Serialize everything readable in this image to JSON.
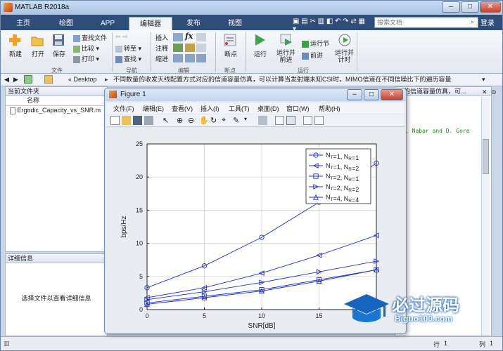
{
  "app": {
    "title": "MATLAB R2018a",
    "window_controls": {
      "minimize": "–",
      "maximize": "□",
      "close": "✕"
    }
  },
  "tabs": [
    {
      "label": "主页"
    },
    {
      "label": "绘图"
    },
    {
      "label": "APP"
    },
    {
      "label": "编辑器",
      "active": true
    },
    {
      "label": "发布"
    },
    {
      "label": "视图"
    }
  ],
  "search": {
    "placeholder": "搜索文档"
  },
  "login_label": "登录",
  "ribbon": {
    "file": {
      "new_label": "新建",
      "open_label": "打开",
      "save_label": "保存",
      "find_files_label": "查找文件",
      "compare_label": "比较",
      "print_label": "打印",
      "section_label": "文件"
    },
    "nav": {
      "goto_label": "转至",
      "find_label": "查找",
      "section_label": "导航"
    },
    "edit": {
      "insert_label": "插入",
      "comment_label": "注释",
      "indent_label": "缩进",
      "fx_label": "fx",
      "section_label": "编辑"
    },
    "breakpoints": {
      "label": "断点",
      "section_label": "断点"
    },
    "run": {
      "run_label": "运行",
      "run_advance_label": "运行并\n前进",
      "run_section_label": "运行节",
      "advance_label": "前进",
      "run_time_label": "运行并\n计时",
      "section_label": "运行"
    }
  },
  "address": {
    "path_prefix": "« Desktop",
    "path_rest": "不同数量的收发天线配置方式对应的信道容量仿真，可以计算当发射端未知CSI时，MIMO信道在不同信噪比下的遍历容量"
  },
  "left_panel": {
    "header": "当前文件夹",
    "column_name": "名称",
    "file_name": "Ergodic_Capacity_vs_SNR.m"
  },
  "detail_panel": {
    "header": "详细信息",
    "message": "选择文件以查看详细信息"
  },
  "editor": {
    "header_text": "应的信道容量仿真，可...",
    "code_line": ", Nabar and D. Gore"
  },
  "status": {
    "row_label": "行",
    "row_value": "1",
    "col_label": "列",
    "col_value": "1"
  },
  "figure": {
    "title": "Figure 1",
    "menu": [
      "文件(F)",
      "编辑(E)",
      "查看(V)",
      "插入(I)",
      "工具(T)",
      "桌面(D)",
      "窗口(W)",
      "帮助(H)"
    ]
  },
  "chart_data": {
    "type": "line",
    "xlabel": "SNR[dB]",
    "ylabel": "bps/Hz",
    "xlim": [
      0,
      20
    ],
    "ylim": [
      0,
      25
    ],
    "xticks": [
      0,
      5,
      10,
      15,
      20
    ],
    "yticks": [
      0,
      5,
      10,
      15,
      20,
      25
    ],
    "grid": true,
    "legend_position": "top-right",
    "color": "#1f2fd6",
    "x": [
      0,
      5,
      10,
      15,
      20
    ],
    "series": [
      {
        "name": "N_T=1, N_R=1",
        "marker": "circle",
        "values": [
          3.3,
          6.6,
          10.9,
          16.2,
          22.1
        ]
      },
      {
        "name": "N_T=1, N_R=2",
        "marker": "triangle-left",
        "values": [
          1.8,
          3.3,
          5.5,
          8.2,
          11.2
        ]
      },
      {
        "name": "N_T=2, N_R=1",
        "marker": "square",
        "values": [
          1.0,
          2.0,
          3.0,
          4.5,
          6.0
        ]
      },
      {
        "name": "N_T=2, N_R=2",
        "marker": "triangle-right",
        "values": [
          1.5,
          2.7,
          4.1,
          5.7,
          7.3
        ]
      },
      {
        "name": "N_T=4, N_R=4",
        "marker": "triangle-up",
        "values": [
          0.8,
          1.8,
          2.8,
          4.3,
          6.0
        ]
      }
    ],
    "legend_entries": [
      {
        "t": "1",
        "r": "1"
      },
      {
        "t": "1",
        "r": "2"
      },
      {
        "t": "2",
        "r": "1"
      },
      {
        "t": "2",
        "r": "2"
      },
      {
        "t": "4",
        "r": "4"
      }
    ]
  },
  "watermark": {
    "text": "必过源码",
    "url": "Biguo100.com"
  }
}
